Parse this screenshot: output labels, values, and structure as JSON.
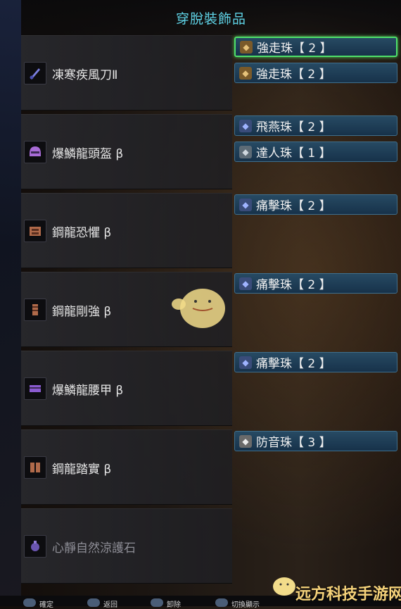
{
  "header": {
    "title": "穿脫裝飾品"
  },
  "equipment": [
    {
      "name": "凍寒疾風刀Ⅱ",
      "icon": "sword-icon",
      "decorations": [
        {
          "label": "強走珠【 2 】",
          "gem": "gold",
          "selected": true
        },
        {
          "label": "強走珠【 2 】",
          "gem": "gold",
          "selected": false
        }
      ]
    },
    {
      "name": "爆鱗龍頭盔 β",
      "icon": "helmet-icon",
      "decorations": [
        {
          "label": "飛燕珠【 2 】",
          "gem": "lv2",
          "selected": false
        },
        {
          "label": "達人珠【 1 】",
          "gem": "lv1",
          "selected": false
        }
      ]
    },
    {
      "name": "鋼龍恐懼 β",
      "icon": "chest-icon",
      "decorations": [
        {
          "label": "痛擊珠【 2 】",
          "gem": "lv2",
          "selected": false
        }
      ]
    },
    {
      "name": "鋼龍剛強 β",
      "icon": "arm-icon",
      "decorations": [
        {
          "label": "痛擊珠【 2 】",
          "gem": "lv2",
          "selected": false
        }
      ]
    },
    {
      "name": "爆鱗龍腰甲 β",
      "icon": "waist-icon",
      "decorations": [
        {
          "label": "痛擊珠【 2 】",
          "gem": "lv2",
          "selected": false
        }
      ]
    },
    {
      "name": "鋼龍踏實 β",
      "icon": "legs-icon",
      "decorations": [
        {
          "label": "防音珠【 3 】",
          "gem": "lv3",
          "selected": false
        }
      ]
    },
    {
      "name": "心靜自然涼護石",
      "icon": "charm-icon",
      "dim": true,
      "decorations": []
    }
  ],
  "footer_hints": [
    "確定",
    "返回",
    "卸除",
    "切換顯示"
  ],
  "watermark": "远方科技手游网",
  "colors": {
    "title": "#5fd3e6",
    "selection": "#4fe06a",
    "deco_bg": "#274a63"
  }
}
